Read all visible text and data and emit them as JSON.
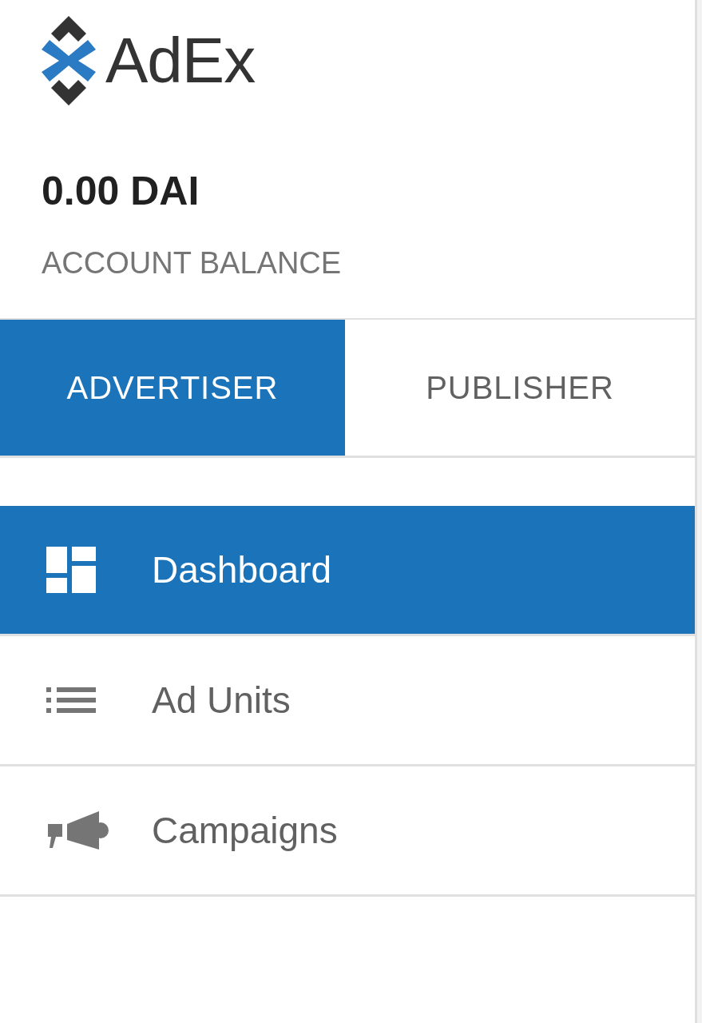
{
  "logo": {
    "text": "AdEx"
  },
  "balance": {
    "amount": "0.00 DAI",
    "label": "ACCOUNT BALANCE"
  },
  "tabs": [
    {
      "label": "ADVERTISER",
      "selected": true
    },
    {
      "label": "PUBLISHER",
      "selected": false
    }
  ],
  "menu": [
    {
      "label": "Dashboard",
      "selected": true
    },
    {
      "label": "Ad Units",
      "selected": false
    },
    {
      "label": "Campaigns",
      "selected": false
    }
  ]
}
